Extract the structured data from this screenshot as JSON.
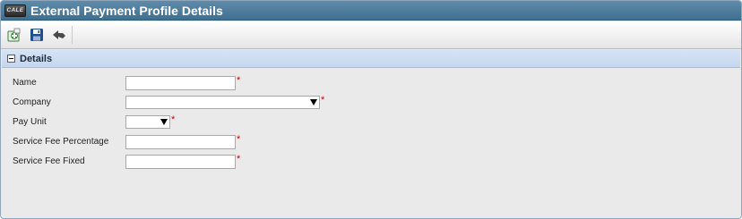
{
  "window": {
    "logo_text": "CALE",
    "title": "External Payment Profile Details"
  },
  "toolbar": {
    "buttons": [
      {
        "icon": "add-icon",
        "tooltip": ""
      },
      {
        "icon": "save-icon",
        "tooltip": ""
      },
      {
        "icon": "back-icon",
        "tooltip": ""
      }
    ],
    "colors": {
      "add": "#3a9a3a",
      "save": "#1f4f8f",
      "back": "#4a4a4a"
    }
  },
  "section": {
    "title": "Details",
    "collapsed": false
  },
  "form": {
    "required_mark": "*",
    "fields": [
      {
        "label": "Name",
        "type": "text",
        "value": "",
        "required": true
      },
      {
        "label": "Company",
        "type": "select",
        "value": "",
        "required": true
      },
      {
        "label": "Pay Unit",
        "type": "select",
        "value": "",
        "required": true
      },
      {
        "label": "Service Fee Percentage",
        "type": "text",
        "value": "",
        "required": true
      },
      {
        "label": "Service Fee Fixed",
        "type": "text",
        "value": "",
        "required": true
      }
    ]
  },
  "colors": {
    "titlebar": "#4a7a9b",
    "section_header": "#c9d9f0",
    "required": "#d00000",
    "background": "#eaeaea"
  }
}
